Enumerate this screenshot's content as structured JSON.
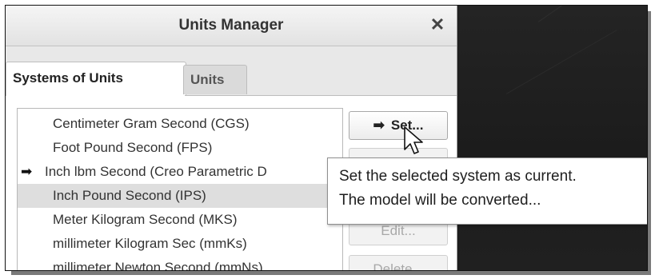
{
  "dialog": {
    "title": "Units Manager",
    "close_glyph": "✕",
    "tabs": [
      {
        "label": "Systems of Units",
        "active": true
      },
      {
        "label": "Units",
        "active": false
      }
    ]
  },
  "systems_list": {
    "items": [
      {
        "label": "Centimeter Gram Second (CGS)",
        "current": false,
        "selected": false,
        "marker": ""
      },
      {
        "label": "Foot Pound Second (FPS)",
        "current": false,
        "selected": false,
        "marker": ""
      },
      {
        "label": "Inch lbm Second (Creo Parametric D",
        "current": true,
        "selected": false,
        "marker": "➡"
      },
      {
        "label": "Inch Pound Second (IPS)",
        "current": false,
        "selected": true,
        "marker": ""
      },
      {
        "label": "Meter Kilogram Second (MKS)",
        "current": false,
        "selected": false,
        "marker": ""
      },
      {
        "label": "millimeter Kilogram Sec (mmKs)",
        "current": false,
        "selected": false,
        "marker": ""
      },
      {
        "label": "millimeter Newton Second (mmNs)",
        "current": false,
        "selected": false,
        "marker": ""
      }
    ]
  },
  "buttons": {
    "set": {
      "label": "Set...",
      "icon": "arrow-right-icon",
      "icon_glyph": "➡"
    },
    "edit": {
      "label": "Edit...",
      "disabled": true
    },
    "delete": {
      "label": "Delete...",
      "disabled": true
    }
  },
  "tooltip": {
    "line1": "Set the selected system as current.",
    "line2": "The model will be converted..."
  },
  "colors": {
    "selected_row": "#dedede",
    "viewport_bg": "#1f1f1f",
    "dialog_bg": "#e8e8e8"
  }
}
